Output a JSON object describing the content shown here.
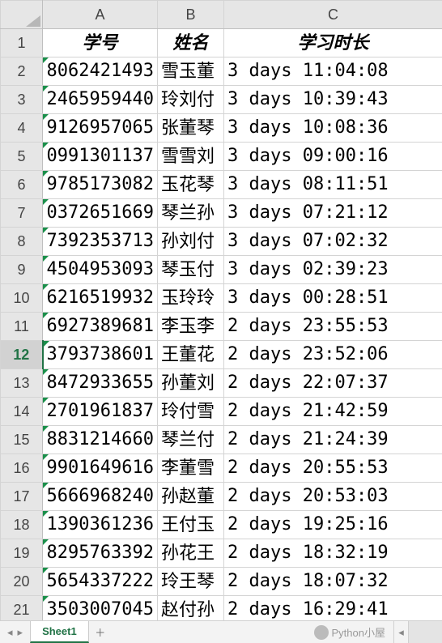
{
  "columns": {
    "A": "A",
    "B": "B",
    "C": "C"
  },
  "headers": {
    "A": "学号",
    "B": "姓名",
    "C": "学习时长"
  },
  "active_row": 12,
  "rows": [
    {
      "n": 2,
      "A": "8062421493",
      "B": "雪玉董",
      "C": "3 days 11:04:08"
    },
    {
      "n": 3,
      "A": "2465959440",
      "B": "玲刘付",
      "C": "3 days 10:39:43"
    },
    {
      "n": 4,
      "A": "9126957065",
      "B": "张董琴",
      "C": "3 days 10:08:36"
    },
    {
      "n": 5,
      "A": "0991301137",
      "B": "雪雪刘",
      "C": "3 days 09:00:16"
    },
    {
      "n": 6,
      "A": "9785173082",
      "B": "玉花琴",
      "C": "3 days 08:11:51"
    },
    {
      "n": 7,
      "A": "0372651669",
      "B": "琴兰孙",
      "C": "3 days 07:21:12"
    },
    {
      "n": 8,
      "A": "7392353713",
      "B": "孙刘付",
      "C": "3 days 07:02:32"
    },
    {
      "n": 9,
      "A": "4504953093",
      "B": "琴玉付",
      "C": "3 days 02:39:23"
    },
    {
      "n": 10,
      "A": "6216519932",
      "B": "玉玲玲",
      "C": "3 days 00:28:51"
    },
    {
      "n": 11,
      "A": "6927389681",
      "B": "李玉李",
      "C": "2 days 23:55:53"
    },
    {
      "n": 12,
      "A": "3793738601",
      "B": "王董花",
      "C": "2 days 23:52:06"
    },
    {
      "n": 13,
      "A": "8472933655",
      "B": "孙董刘",
      "C": "2 days 22:07:37"
    },
    {
      "n": 14,
      "A": "2701961837",
      "B": "玲付雪",
      "C": "2 days 21:42:59"
    },
    {
      "n": 15,
      "A": "8831214660",
      "B": "琴兰付",
      "C": "2 days 21:24:39"
    },
    {
      "n": 16,
      "A": "9901649616",
      "B": "李董雪",
      "C": "2 days 20:55:53"
    },
    {
      "n": 17,
      "A": "5666968240",
      "B": "孙赵董",
      "C": "2 days 20:53:03"
    },
    {
      "n": 18,
      "A": "1390361236",
      "B": "王付玉",
      "C": "2 days 19:25:16"
    },
    {
      "n": 19,
      "A": "8295763392",
      "B": "孙花王",
      "C": "2 days 18:32:19"
    },
    {
      "n": 20,
      "A": "5654337222",
      "B": "玲王琴",
      "C": "2 days 18:07:32"
    },
    {
      "n": 21,
      "A": "3503007045",
      "B": "赵付孙",
      "C": "2 days 16:29:41"
    }
  ],
  "tabs": {
    "sheet": "Sheet1",
    "add": "＋"
  },
  "nav": {
    "first": "|◂",
    "prev": "◂",
    "next": "▸",
    "last": "▸|"
  },
  "watermark": "Python小屋",
  "scroll_left_glyph": "◂"
}
